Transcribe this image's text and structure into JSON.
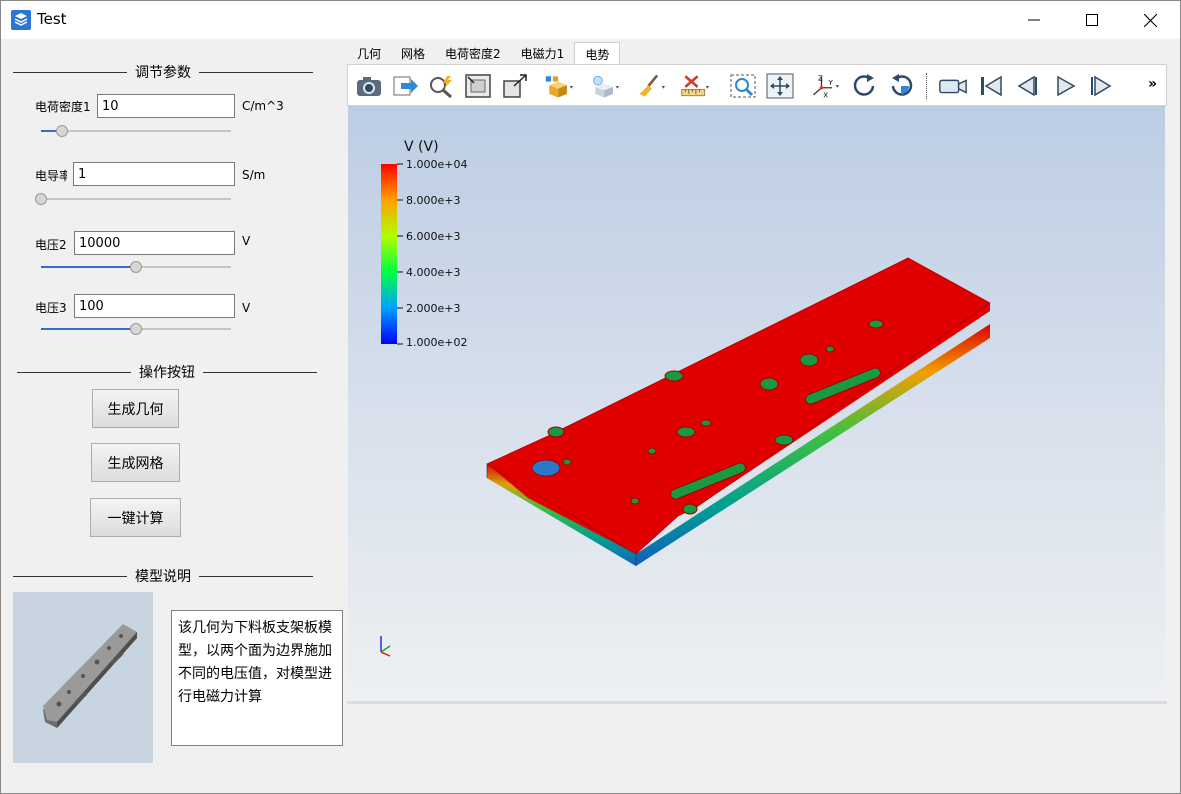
{
  "window": {
    "title": "Test"
  },
  "left": {
    "params_title": "调节参数",
    "params": [
      {
        "label": "电荷密度1",
        "value": "10",
        "unit": "C/m^3",
        "slider": 0.11
      },
      {
        "label": "电导率",
        "value": "1",
        "unit": "S/m",
        "slider": 0.0
      },
      {
        "label": "电压2",
        "value": "10000",
        "unit": "V",
        "slider": 0.5
      },
      {
        "label": "电压3",
        "value": "100",
        "unit": "V",
        "slider": 0.5
      }
    ],
    "actions_title": "操作按钮",
    "buttons": {
      "geometry": "生成几何",
      "mesh": "生成网格",
      "compute": "一键计算"
    },
    "model_title": "模型说明",
    "description": "该几何为下料板支架板模型，以两个面为边界施加不同的电压值，对模型进行电磁力计算"
  },
  "tabs": [
    {
      "label": "几何",
      "active": false
    },
    {
      "label": "网格",
      "active": false
    },
    {
      "label": "电荷密度2",
      "active": false
    },
    {
      "label": "电磁力1",
      "active": false
    },
    {
      "label": "电势",
      "active": true
    }
  ],
  "toolbar": {
    "icons": [
      "camera-icon",
      "export-icon",
      "pick-icon",
      "fit-view-icon",
      "view-direction-icon",
      "color-cube-icon",
      "light-icon",
      "brush-icon",
      "ruler-clear-icon",
      "zoom-box-icon",
      "pan-icon",
      "axes-icon",
      "rotate-cw-icon",
      "rotate-ccw-icon",
      "record-icon",
      "first-frame-icon",
      "prev-frame-icon",
      "play-icon",
      "next-frame-icon"
    ],
    "overflow": "»"
  },
  "legend": {
    "title": "V (V)",
    "ticks": [
      "1.000e+04",
      "8.000e+3",
      "6.000e+3",
      "4.000e+3",
      "2.000e+3",
      "1.000e+02"
    ],
    "min": 100,
    "max": 10000
  },
  "axes": {
    "x": "X",
    "y": "Y",
    "z": "Z"
  },
  "colors": {
    "slider_fill": "#2f6fd4",
    "result_high": "#e60000",
    "viewport_top": "#bccde4"
  }
}
